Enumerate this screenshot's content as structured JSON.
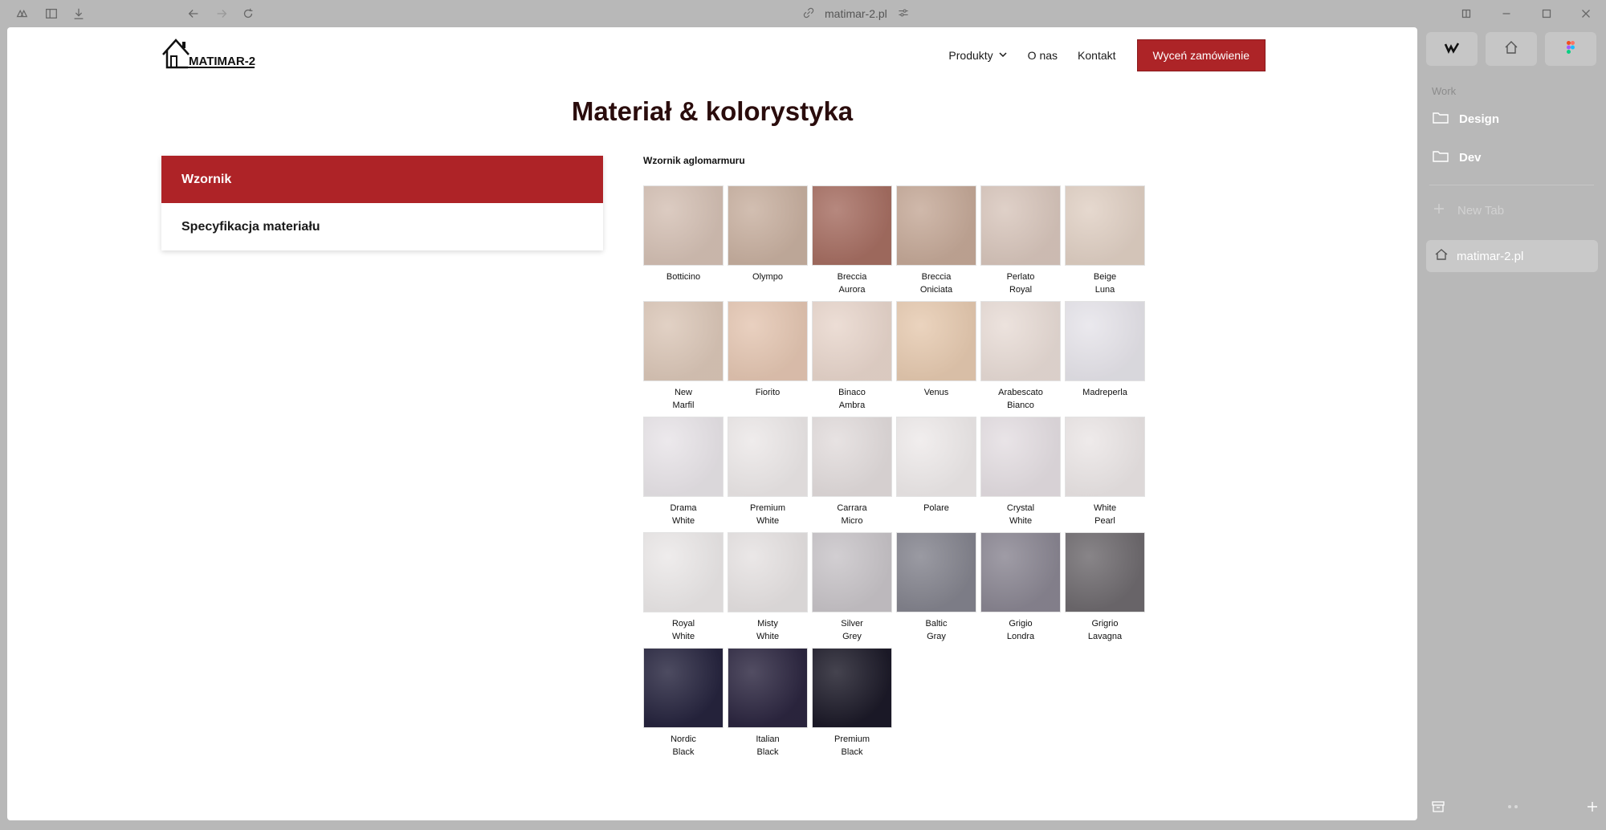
{
  "browser": {
    "url": "matimar-2.pl"
  },
  "header": {
    "logo_text": "MATIMAR-2",
    "nav": {
      "produkty": "Produkty",
      "o_nas": "O nas",
      "kontakt": "Kontakt"
    },
    "cta": "Wyceń zamówienie"
  },
  "page": {
    "title": "Materiał & kolorystyka",
    "tabs": [
      {
        "label": "Wzornik",
        "active": true
      },
      {
        "label": "Specyfikacja materiału",
        "active": false
      }
    ],
    "swatch_title": "Wzornik aglomarmuru"
  },
  "swatches": [
    {
      "name": "Botticino",
      "color": "#d4c0b4"
    },
    {
      "name": "Olympo",
      "color": "#c8b0a0"
    },
    {
      "name": "Breccia\nAurora",
      "color": "#a66e62"
    },
    {
      "name": "Breccia\nOniciata",
      "color": "#c5a998"
    },
    {
      "name": "Perlato\nRoyal",
      "color": "#d8c6bc"
    },
    {
      "name": "Beige\nLuna",
      "color": "#e0d0c4"
    },
    {
      "name": "New\nMarfil",
      "color": "#dbc7b8"
    },
    {
      "name": "Fiorito",
      "color": "#e4c6b2"
    },
    {
      "name": "Binaco\nAmbra",
      "color": "#e8d6cc"
    },
    {
      "name": "Venus",
      "color": "#e6cab0"
    },
    {
      "name": "Arabescato\nBianco",
      "color": "#e8dcd6"
    },
    {
      "name": "Madreperla",
      "color": "#e6e4ea"
    },
    {
      "name": "Drama\nWhite",
      "color": "#e8e4e8"
    },
    {
      "name": "Premium\nWhite",
      "color": "#ece8e8"
    },
    {
      "name": "Carrara\nMicro",
      "color": "#e2dcdc"
    },
    {
      "name": "Polare",
      "color": "#eeeaea"
    },
    {
      "name": "Crystal\nWhite",
      "color": "#e4dee2"
    },
    {
      "name": "White\nPearl",
      "color": "#ebe6e6"
    },
    {
      "name": "Royal\nWhite",
      "color": "#ebe8e8"
    },
    {
      "name": "Misty\nWhite",
      "color": "#e6e2e2"
    },
    {
      "name": "Silver\nGrey",
      "color": "#c8c4c8"
    },
    {
      "name": "Baltic\nGray",
      "color": "#84848e"
    },
    {
      "name": "Grigio\nLondra",
      "color": "#8a8692"
    },
    {
      "name": "Grigrio\nLavagna",
      "color": "#6e6a6e"
    },
    {
      "name": "Nordic\nBlack",
      "color": "#26243e"
    },
    {
      "name": "Italian\nBlack",
      "color": "#2c2640"
    },
    {
      "name": "Premium\nBlack",
      "color": "#1c1a28"
    }
  ],
  "sidebar": {
    "section_label": "Work",
    "folders": [
      "Design",
      "Dev"
    ],
    "new_tab": "New Tab",
    "current_tab": "matimar-2.pl"
  },
  "colors": {
    "accent": "#ae2327",
    "title": "#2a0c0c",
    "chrome": "#b8b8b8"
  }
}
